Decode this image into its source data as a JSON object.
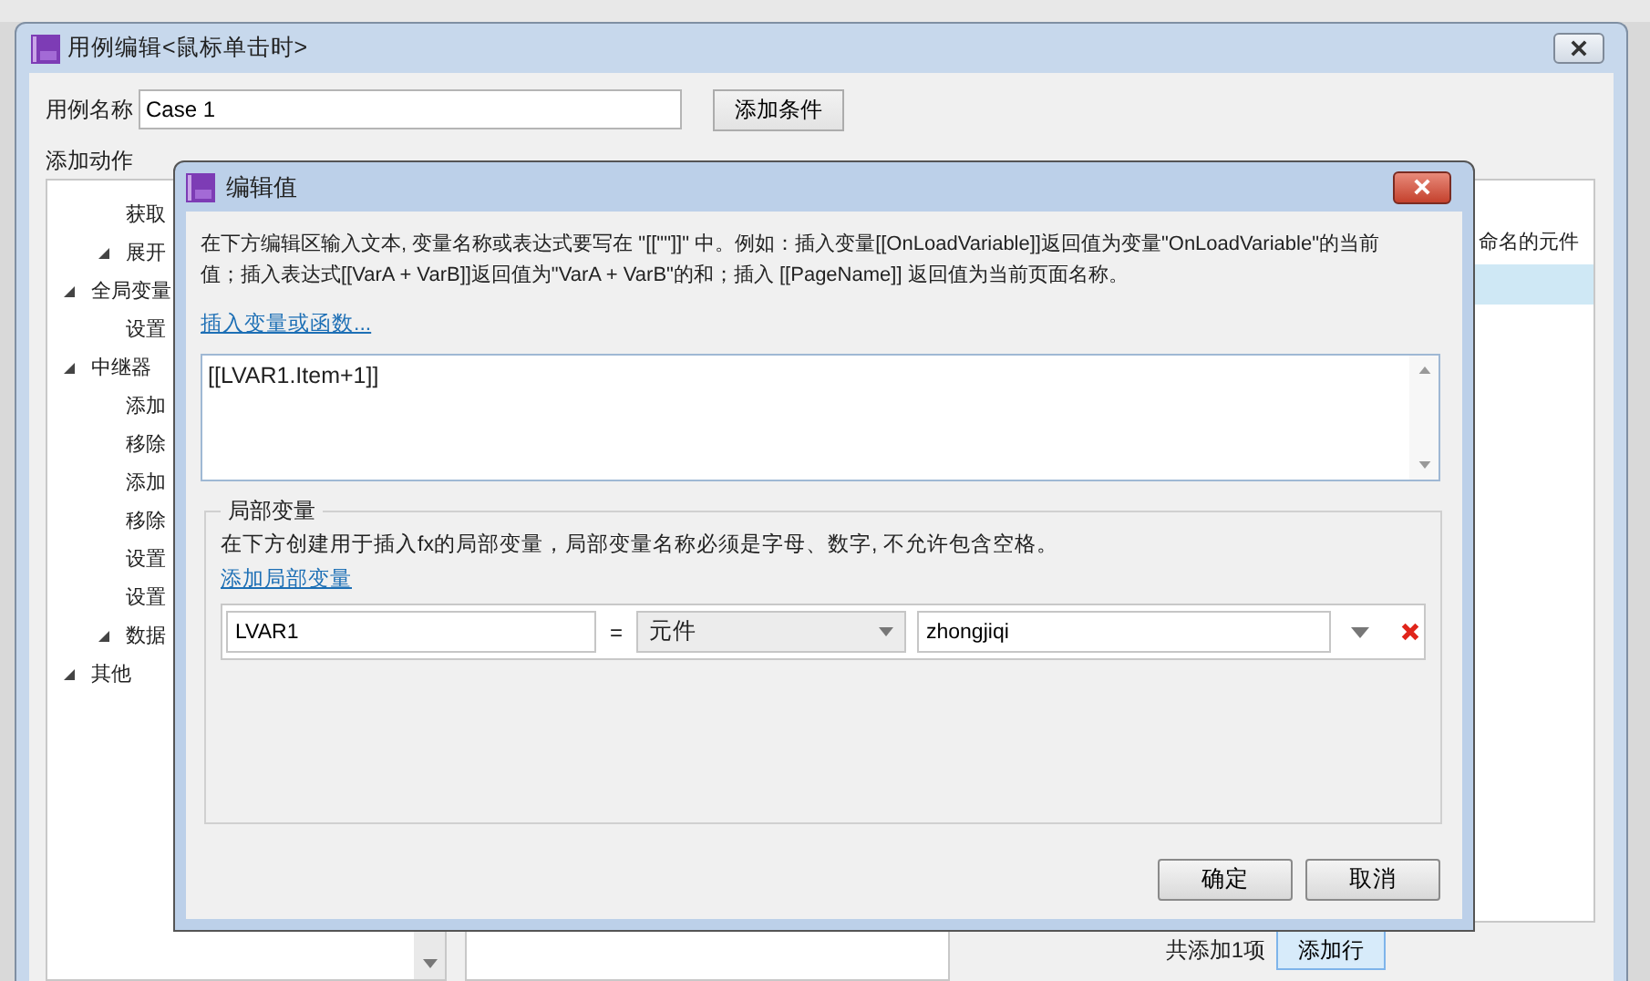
{
  "window": {
    "title": "用例编辑<鼠标单击时>"
  },
  "case_name": {
    "label": "用例名称",
    "value": "Case 1"
  },
  "add_condition_button": "添加条件",
  "add_action": {
    "heading": "添加动作",
    "tree": [
      {
        "children": [
          {
            "label": "获取"
          },
          {
            "label": "展开",
            "expanded": true
          }
        ]
      },
      {
        "label": "全局变量",
        "expanded": true,
        "children": [
          {
            "label": "设置"
          }
        ]
      },
      {
        "label": "中继器",
        "expanded": true,
        "children": [
          {
            "label": "添加"
          },
          {
            "label": "移除"
          },
          {
            "label": "添加"
          },
          {
            "label": "移除"
          },
          {
            "label": "设置"
          },
          {
            "label": "设置"
          },
          {
            "label": "数据",
            "expanded": true
          }
        ]
      },
      {
        "label": "其他",
        "expanded": true
      }
    ]
  },
  "configure_panel": {
    "column_header": "命名的元件",
    "rows": [
      {
        "selected": true
      }
    ]
  },
  "footer": {
    "count": "共添加1项",
    "add_row_button": "添加行"
  },
  "dialog": {
    "title": "编辑值",
    "instructions": "在下方编辑区输入文本, 变量名称或表达式要写在 \"[[\"\"]]\" 中。例如：插入变量[[OnLoadVariable]]返回值为变量\"OnLoadVariable\"的当前值；插入表达式[[VarA + VarB]]返回值为\"VarA + VarB\"的和；插入 [[PageName]] 返回值为当前页面名称。",
    "insert_link": "插入变量或函数...",
    "expression": "[[LVAR1.Item+1]]",
    "local_variables": {
      "legend": "局部变量",
      "description": "在下方创建用于插入fx的局部变量，局部变量名称必须是字母、数字, 不允许包含空格。",
      "add_link": "添加局部变量",
      "rows": [
        {
          "name": "LVAR1",
          "equals": "=",
          "type": "元件",
          "value": "zhongjiqi"
        }
      ]
    },
    "buttons": [
      "确定",
      "取消"
    ]
  }
}
